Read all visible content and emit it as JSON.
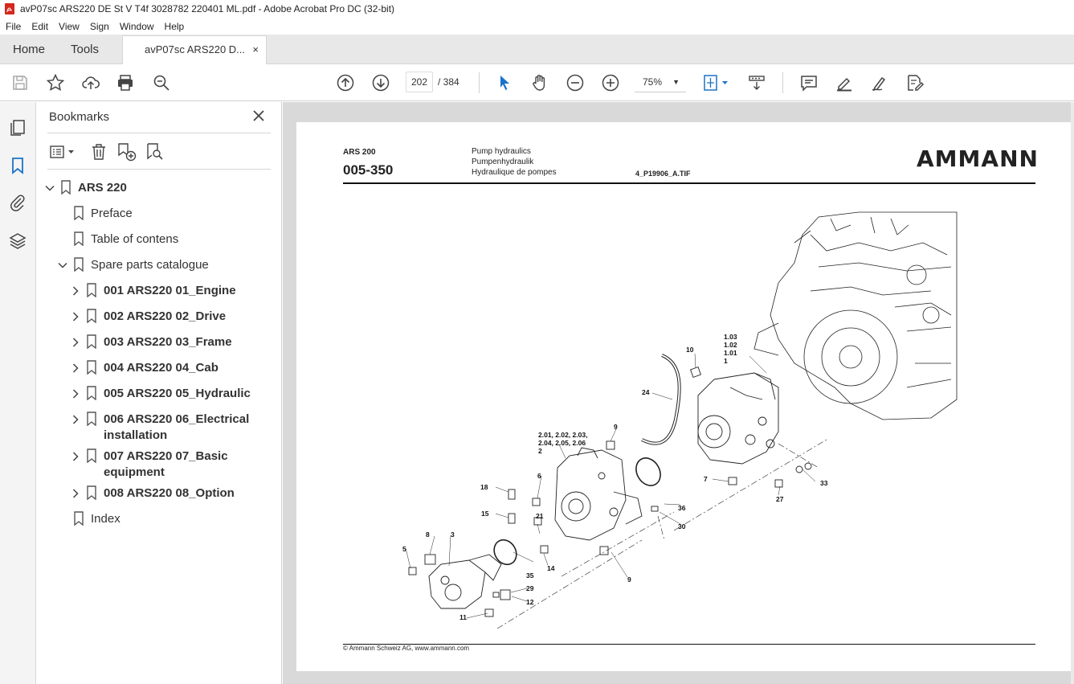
{
  "window": {
    "title": "avP07sc ARS220 DE St V T4f 3028782 220401 ML.pdf - Adobe Acrobat Pro DC (32-bit)"
  },
  "menu": [
    "File",
    "Edit",
    "View",
    "Sign",
    "Window",
    "Help"
  ],
  "tabs": {
    "home": "Home",
    "tools": "Tools",
    "doc": "avP07sc ARS220 D...",
    "close": "×"
  },
  "toolbar": {
    "page_current": "202",
    "page_total": "/ 384",
    "zoom": "75%"
  },
  "panel": {
    "title": "Bookmarks",
    "items": [
      {
        "label": "ARS 220",
        "bold": true,
        "chev": "down"
      },
      {
        "label": "Preface"
      },
      {
        "label": "Table of contens"
      },
      {
        "label": "Spare parts catalogue",
        "chev": "down"
      },
      {
        "label": "001 ARS220 01_Engine",
        "bold": true,
        "chev": "right"
      },
      {
        "label": "002 ARS220 02_Drive",
        "bold": true,
        "chev": "right"
      },
      {
        "label": "003 ARS220 03_Frame",
        "bold": true,
        "chev": "right"
      },
      {
        "label": "004 ARS220 04_Cab",
        "bold": true,
        "chev": "right"
      },
      {
        "label": "005 ARS220 05_Hydraulic",
        "bold": true,
        "chev": "right"
      },
      {
        "label": "006 ARS220 06_Electrical",
        "label2": "installation",
        "bold": true,
        "chev": "right"
      },
      {
        "label": "007 ARS220 07_Basic",
        "label2": "equipment",
        "bold": true,
        "chev": "right"
      },
      {
        "label": "008 ARS220 08_Option",
        "bold": true,
        "chev": "right"
      },
      {
        "label": "Index"
      }
    ]
  },
  "document": {
    "model": "ARS 200",
    "code": "005-350",
    "title_en": "Pump hydraulics",
    "title_de": "Pumpenhydraulik",
    "title_fr": "Hydraulique de pompes",
    "file": "4_P19906_A.TIF",
    "logo": "AMMANN",
    "footer": "© Ammann Schweiz AG, www.ammann.com",
    "part_labels": [
      "1.03",
      "1.02",
      "1.01",
      "1",
      "10",
      "24",
      "9",
      "2.01, 2.02, 2.03,",
      "2.04, 2.05, 2.06",
      "2",
      "6",
      "18",
      "15",
      "21",
      "7",
      "27",
      "33",
      "36",
      "30",
      "8",
      "3",
      "5",
      "35",
      "14",
      "9",
      "29",
      "12",
      "11"
    ]
  }
}
